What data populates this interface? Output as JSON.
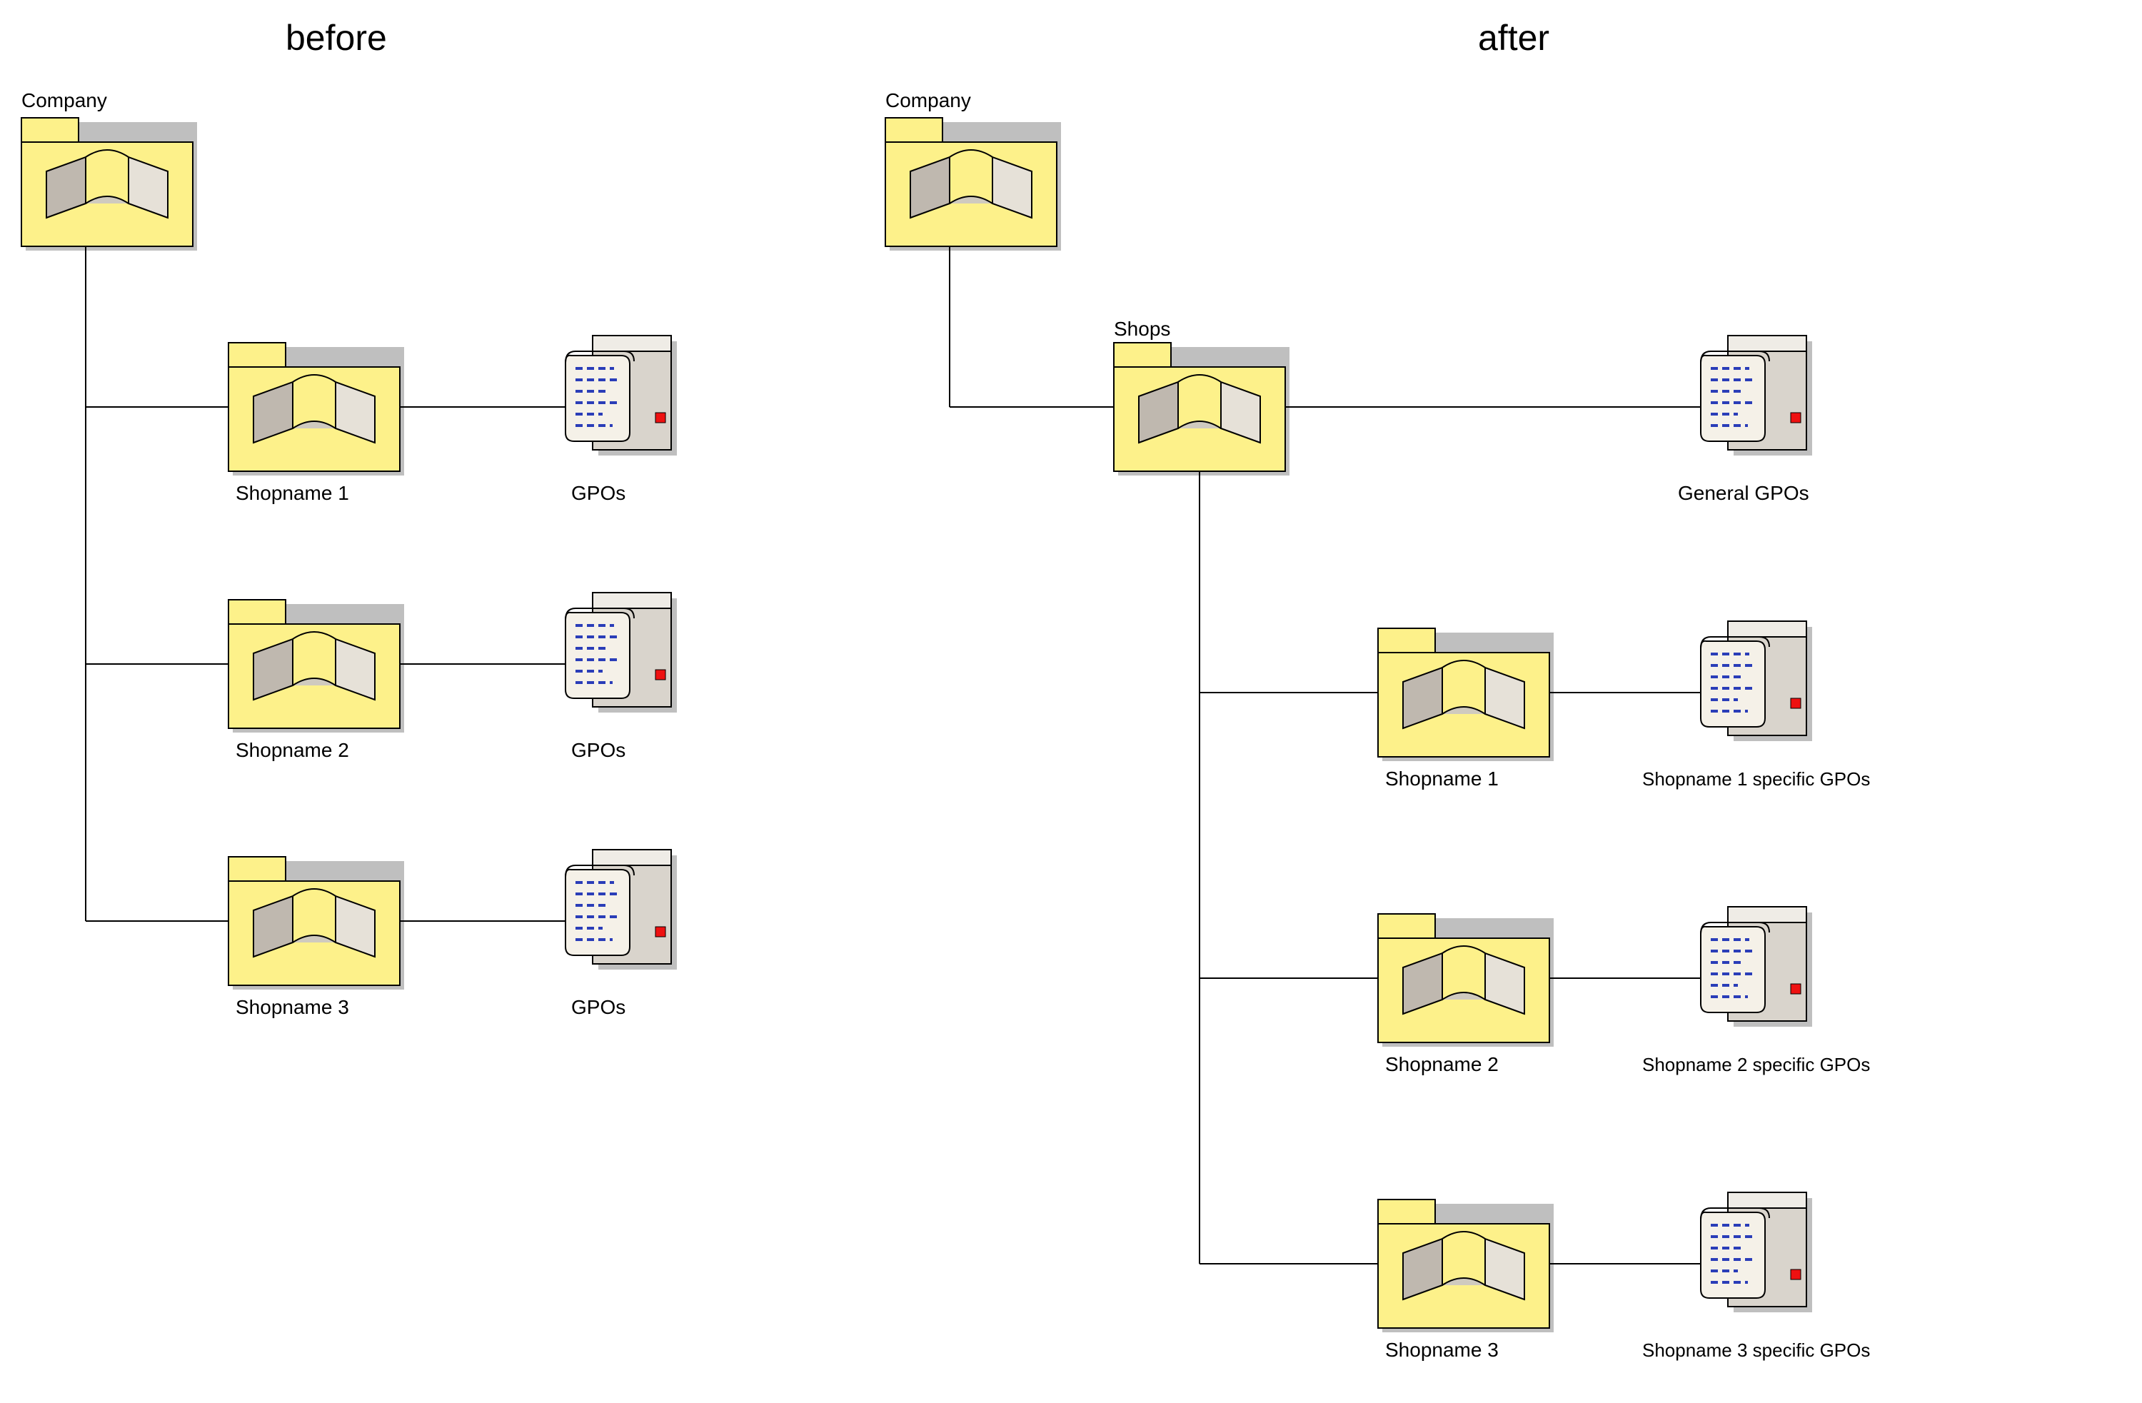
{
  "before": {
    "title": "before",
    "root_label": "Company",
    "children": [
      {
        "label": "Shopname 1",
        "gpo": "GPOs"
      },
      {
        "label": "Shopname 2",
        "gpo": "GPOs"
      },
      {
        "label": "Shopname 3",
        "gpo": "GPOs"
      }
    ]
  },
  "after": {
    "title": "after",
    "root_label": "Company",
    "shops_label": "Shops",
    "shops_gpo": "General GPOs",
    "children": [
      {
        "label": "Shopname 1",
        "gpo": "Shopname 1 specific GPOs"
      },
      {
        "label": "Shopname 2",
        "gpo": "Shopname 2 specific GPOs"
      },
      {
        "label": "Shopname 3",
        "gpo": "Shopname 3 specific GPOs"
      }
    ]
  }
}
